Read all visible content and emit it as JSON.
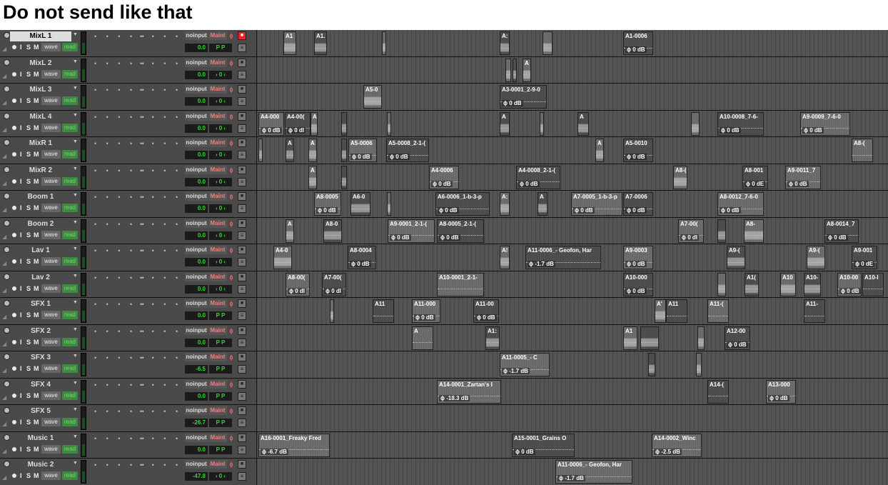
{
  "page": {
    "title": "Do not send like that"
  },
  "io_label": "noinput",
  "bus_label": "Maint",
  "phase_glyph": "ϕ",
  "tracks": [
    {
      "name": "MixL 1",
      "volume": "0.0",
      "pan": "P  P",
      "selected": true,
      "record_armed": true,
      "clips": [
        {
          "n": "A1",
          "l": 37,
          "w": 18
        },
        {
          "n": "A1.",
          "l": 80,
          "w": 18
        },
        {
          "n": "",
          "l": 175,
          "w": 6
        },
        {
          "n": "A:",
          "l": 340,
          "w": 14
        },
        {
          "n": "",
          "l": 400,
          "w": 14
        },
        {
          "n": "A1-0006",
          "l": 513,
          "w": 42,
          "g": "0 dB"
        }
      ]
    },
    {
      "name": "MixL 2",
      "volume": "0.0",
      "pan": "› 0 ‹",
      "clips": [
        {
          "n": "",
          "l": 348,
          "w": 8
        },
        {
          "n": "",
          "l": 358,
          "w": 6
        },
        {
          "n": "A",
          "l": 372,
          "w": 12
        }
      ]
    },
    {
      "name": "MixL 3",
      "volume": "0.0",
      "pan": "› 0 ‹",
      "clips": [
        {
          "n": "A5-0",
          "l": 149,
          "w": 26
        },
        {
          "n": "A3-0001_2-9-0",
          "l": 340,
          "w": 66,
          "g": "0 dB"
        }
      ]
    },
    {
      "name": "MixL 4",
      "volume": "0.0",
      "pan": "› 0 ‹",
      "clips": [
        {
          "n": "A4-000",
          "l": 2,
          "w": 36,
          "g": "0 dB"
        },
        {
          "n": "A4-00(",
          "l": 39,
          "w": 36,
          "g": "0 dI"
        },
        {
          "n": "A",
          "l": 75,
          "w": 10
        },
        {
          "n": "",
          "l": 118,
          "w": 8
        },
        {
          "n": "",
          "l": 182,
          "w": 6
        },
        {
          "n": "A",
          "l": 340,
          "w": 14
        },
        {
          "n": "",
          "l": 396,
          "w": 6
        },
        {
          "n": "A",
          "l": 449,
          "w": 16
        },
        {
          "n": "",
          "l": 608,
          "w": 12
        },
        {
          "n": "A10-0008_7-6-",
          "l": 645,
          "w": 65,
          "g": "0 dB"
        },
        {
          "n": "A9-0009_7-6-0",
          "l": 761,
          "w": 70,
          "g": "0 dB"
        }
      ]
    },
    {
      "name": "MixR 1",
      "volume": "0.0",
      "pan": "› 0 ‹",
      "clips": [
        {
          "n": "",
          "l": 2,
          "w": 6
        },
        {
          "n": "A",
          "l": 40,
          "w": 12
        },
        {
          "n": "A",
          "l": 72,
          "w": 12
        },
        {
          "n": "",
          "l": 118,
          "w": 8
        },
        {
          "n": "A5-0006",
          "l": 128,
          "w": 40,
          "g": "0 dB"
        },
        {
          "n": "A5-0008_2-1-(",
          "l": 181,
          "w": 60,
          "g": "0 dB"
        },
        {
          "n": "A",
          "l": 474,
          "w": 12
        },
        {
          "n": "A5-0010",
          "l": 513,
          "w": 42,
          "g": "0 dB"
        },
        {
          "n": "A8-(",
          "l": 833,
          "w": 30
        }
      ]
    },
    {
      "name": "MixR 2",
      "volume": "0.0",
      "pan": "› 0 ‹",
      "clips": [
        {
          "n": "A",
          "l": 72,
          "w": 12
        },
        {
          "n": "",
          "l": 118,
          "w": 8
        },
        {
          "n": "A4-0006",
          "l": 241,
          "w": 42,
          "g": "0 dB"
        },
        {
          "n": "A4-0008_2-1-(",
          "l": 363,
          "w": 62,
          "g": "0 dB"
        },
        {
          "n": "A8-(",
          "l": 583,
          "w": 20
        },
        {
          "n": "A8-001",
          "l": 680,
          "w": 36,
          "g": "0 dE"
        },
        {
          "n": "A9-0011_7",
          "l": 740,
          "w": 50,
          "g": "0 dB"
        }
      ]
    },
    {
      "name": "Boom 1",
      "volume": "0.0",
      "pan": "› 0 ‹",
      "clips": [
        {
          "n": "A8-0005",
          "l": 80,
          "w": 38,
          "g": "0 dB"
        },
        {
          "n": "A6-0",
          "l": 131,
          "w": 28
        },
        {
          "n": "",
          "l": 182,
          "w": 6
        },
        {
          "n": "A6-0006_1-b-3-p",
          "l": 250,
          "w": 76,
          "g": "0 dB"
        },
        {
          "n": "A:",
          "l": 340,
          "w": 14
        },
        {
          "n": "A",
          "l": 393,
          "w": 14
        },
        {
          "n": "A7-0005_1-b-3-p",
          "l": 440,
          "w": 72,
          "g": "0 dB"
        },
        {
          "n": "A7-0006",
          "l": 513,
          "w": 42,
          "g": "0 dB"
        },
        {
          "n": "A8-0012_7-6-0",
          "l": 645,
          "w": 65,
          "g": "0 dB"
        }
      ]
    },
    {
      "name": "Boom 2",
      "volume": "0.0",
      "pan": "› 0 ‹",
      "clips": [
        {
          "n": "A",
          "l": 40,
          "w": 12
        },
        {
          "n": "A8-0",
          "l": 93,
          "w": 26
        },
        {
          "n": "A9-0001_2-1-(",
          "l": 183,
          "w": 66,
          "g": "0 dB"
        },
        {
          "n": "A8-0005_2-1-(",
          "l": 252,
          "w": 66,
          "g": "0 dB"
        },
        {
          "n": "A7-00(",
          "l": 590,
          "w": 36,
          "g": "0 dl"
        },
        {
          "n": "",
          "l": 645,
          "w": 12
        },
        {
          "n": "A8-",
          "l": 682,
          "w": 28
        },
        {
          "n": "A8-0014_7",
          "l": 795,
          "w": 48,
          "g": "0 dB"
        }
      ]
    },
    {
      "name": "Lav 1",
      "volume": "0.0",
      "pan": "› 0 ‹",
      "clips": [
        {
          "n": "A4-0",
          "l": 23,
          "w": 26
        },
        {
          "n": "A8-0004",
          "l": 127,
          "w": 40,
          "g": "0 dB"
        },
        {
          "n": "A!",
          "l": 340,
          "w": 14
        },
        {
          "n": "A11-0006_- Geofon, Har",
          "l": 376,
          "w": 106,
          "g": "-1.7 dB"
        },
        {
          "n": "A9-0003",
          "l": 513,
          "w": 42,
          "g": "0 dB"
        },
        {
          "n": "A9-(",
          "l": 658,
          "w": 26
        },
        {
          "n": "A9-(",
          "l": 770,
          "w": 26
        },
        {
          "n": "A9-001",
          "l": 833,
          "w": 36,
          "g": "0 dE"
        }
      ]
    },
    {
      "name": "Lav 2",
      "volume": "0.0",
      "pan": "› 0 ‹",
      "clips": [
        {
          "n": "A8-00(",
          "l": 40,
          "w": 34,
          "g": "0 dl"
        },
        {
          "n": "A7-00(",
          "l": 91,
          "w": 34,
          "g": "0 dl"
        },
        {
          "n": "A10-0001_2-1-",
          "l": 252,
          "w": 66
        },
        {
          "n": "A10-000",
          "l": 513,
          "w": 42,
          "g": "0 dB"
        },
        {
          "n": "",
          "l": 645,
          "w": 12
        },
        {
          "n": "A1(",
          "l": 683,
          "w": 20
        },
        {
          "n": "A10",
          "l": 733,
          "w": 22
        },
        {
          "n": "A10-",
          "l": 766,
          "w": 24
        },
        {
          "n": "A10-00",
          "l": 813,
          "w": 34,
          "g": "0 dB"
        },
        {
          "n": "A10-I",
          "l": 848,
          "w": 30
        }
      ]
    },
    {
      "name": "SFX 1",
      "volume": "0.0",
      "pan": "P  P",
      "clips": [
        {
          "n": "",
          "l": 102,
          "w": 6
        },
        {
          "n": "A11",
          "l": 162,
          "w": 30
        },
        {
          "n": "A11-000",
          "l": 217,
          "w": 40,
          "g": "0 dB"
        },
        {
          "n": "A11-00",
          "l": 303,
          "w": 36,
          "g": "0 dB"
        },
        {
          "n": "A'",
          "l": 557,
          "w": 16
        },
        {
          "n": "A11",
          "l": 573,
          "w": 30
        },
        {
          "n": "A11-(",
          "l": 631,
          "w": 30
        },
        {
          "n": "A11-",
          "l": 766,
          "w": 30
        }
      ]
    },
    {
      "name": "SFX 2",
      "volume": "0.0",
      "pan": "P  P",
      "clips": [
        {
          "n": "A",
          "l": 217,
          "w": 30
        },
        {
          "n": "A1:",
          "l": 320,
          "w": 20
        },
        {
          "n": "A1",
          "l": 513,
          "w": 20
        },
        {
          "n": "",
          "l": 537,
          "w": 26
        },
        {
          "n": "",
          "l": 617,
          "w": 10
        },
        {
          "n": "A12-00",
          "l": 655,
          "w": 36,
          "g": "0 dB"
        }
      ]
    },
    {
      "name": "SFX 3",
      "volume": "-6.5",
      "pan": "P  P",
      "clips": [
        {
          "n": "A11-0005_- C",
          "l": 340,
          "w": 70,
          "g": "-1.7 dB"
        },
        {
          "n": "",
          "l": 548,
          "w": 10
        },
        {
          "n": "",
          "l": 615,
          "w": 8
        }
      ]
    },
    {
      "name": "SFX 4",
      "volume": "0.0",
      "pan": "P  P",
      "clips": [
        {
          "n": "A14-0001_Zartan's I",
          "l": 252,
          "w": 90,
          "g": "-18.3 dB"
        },
        {
          "n": "A14-(",
          "l": 631,
          "w": 30
        },
        {
          "n": "A13-000",
          "l": 713,
          "w": 42,
          "g": "0 dB"
        }
      ]
    },
    {
      "name": "SFX 5",
      "volume": "-26.7",
      "pan": "P  P",
      "clips": []
    },
    {
      "name": "Music 1",
      "volume": "0.0",
      "pan": "P  P",
      "clips": [
        {
          "n": "A16-0001_Freaky Fred",
          "l": 2,
          "w": 100,
          "g": "-6.7 dB"
        },
        {
          "n": "A15-0001_Grains O",
          "l": 357,
          "w": 88,
          "g": "0 dB"
        },
        {
          "n": "A14-0002_Winc",
          "l": 553,
          "w": 70,
          "g": "-2.5 dB"
        }
      ]
    },
    {
      "name": "Music 2",
      "volume": "-47.8",
      "pan": "› 0 ‹",
      "clips": [
        {
          "n": "A11-0006_- Geofon, Har",
          "l": 418,
          "w": 108,
          "g": "-1.7 dB"
        }
      ]
    }
  ]
}
